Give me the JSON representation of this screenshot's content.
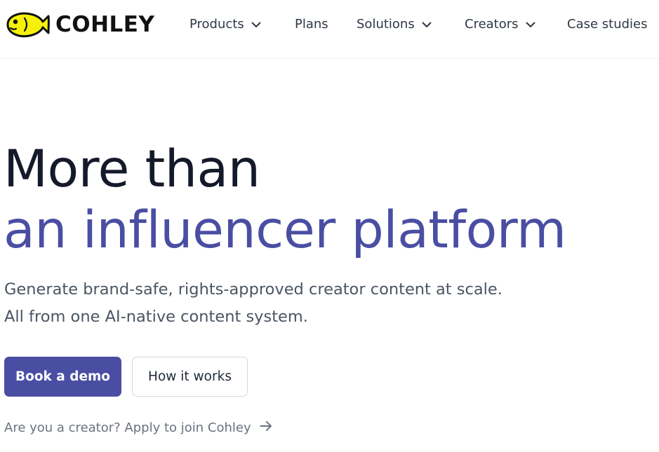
{
  "brand": {
    "name": "COHLEY",
    "logo_icon": "fish-icon",
    "logo_color": "#f5f10a"
  },
  "nav": {
    "items": [
      {
        "label": "Products",
        "has_dropdown": true
      },
      {
        "label": "Plans",
        "has_dropdown": false
      },
      {
        "label": "Solutions",
        "has_dropdown": true
      },
      {
        "label": "Creators",
        "has_dropdown": true
      },
      {
        "label": "Case studies",
        "has_dropdown": false
      }
    ]
  },
  "hero": {
    "title_line1": "More than",
    "title_line2": "an influencer platform",
    "subtitle_line1": "Generate brand-safe, rights-approved creator content at scale.",
    "subtitle_line2": "All from one AI-native content system.",
    "primary_button": "Book a demo",
    "secondary_button": "How it works",
    "creator_link": "Are you a creator? Apply to join Cohley",
    "creator_link_icon": "arrow-right-icon"
  },
  "colors": {
    "accent": "#4a4ea3",
    "heading": "#141a2a",
    "body_text": "#4b5563"
  }
}
